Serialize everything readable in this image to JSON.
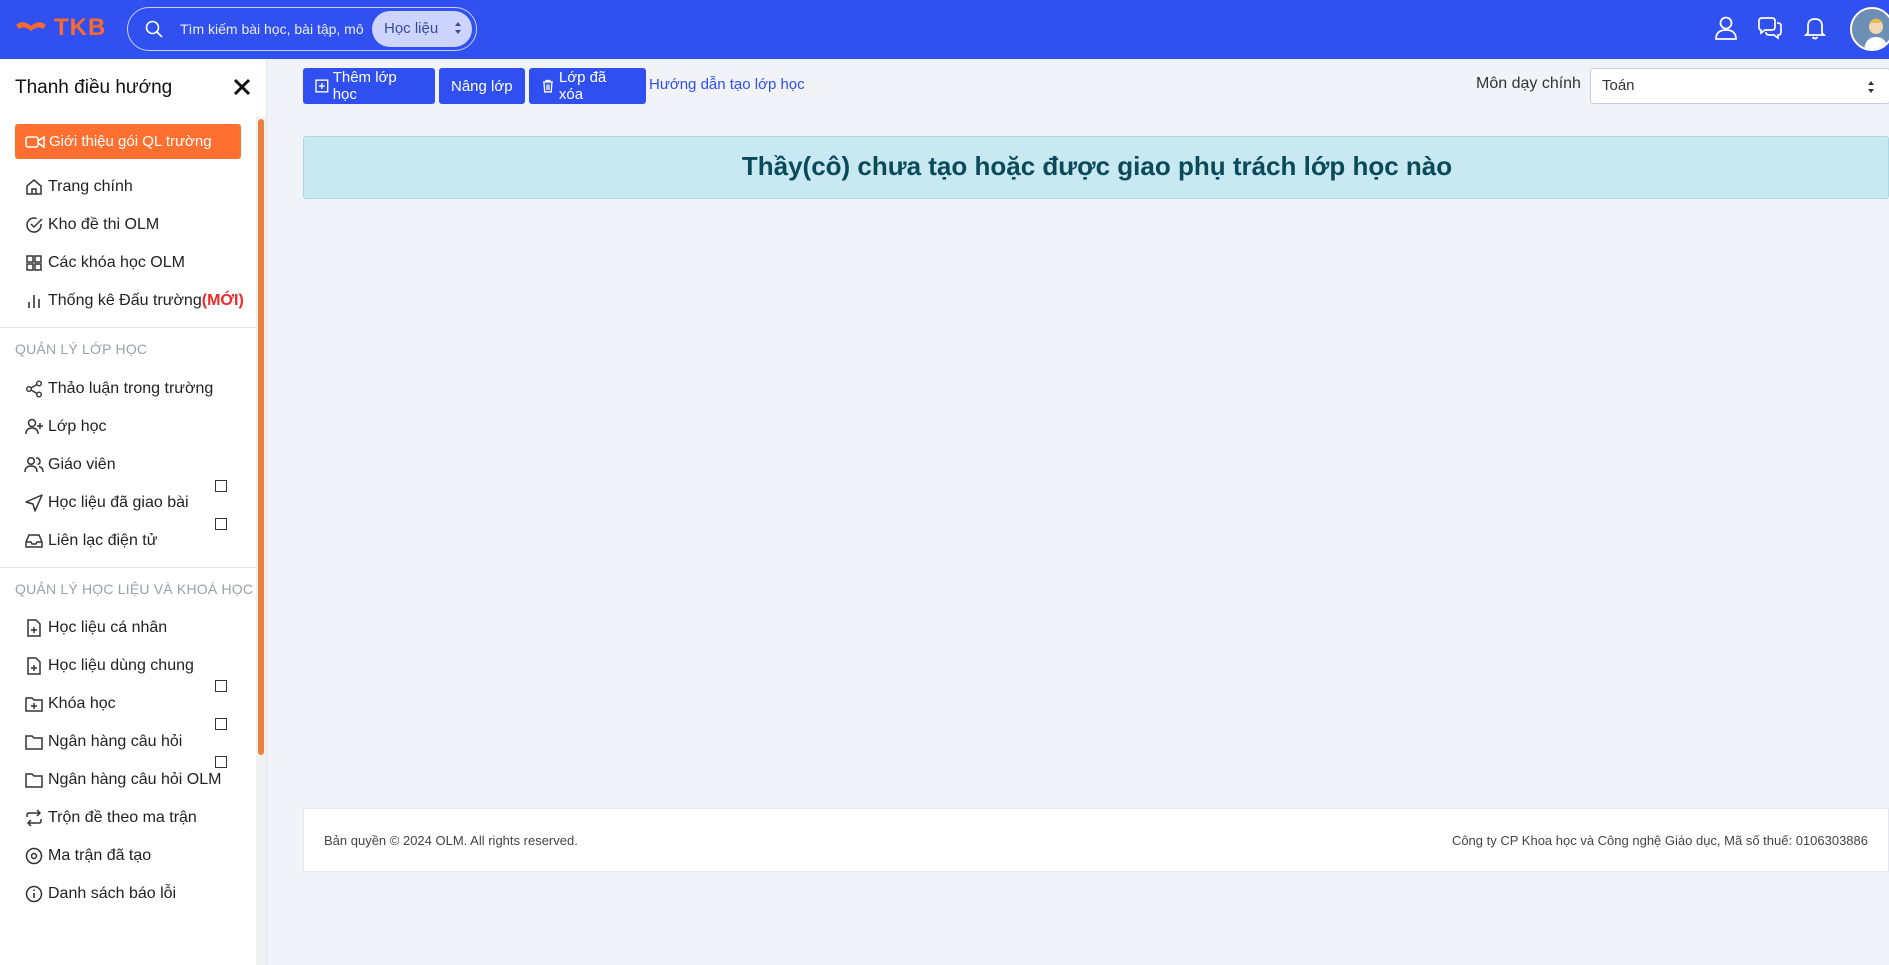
{
  "header": {
    "logo_text": "TKB",
    "search_placeholder": "Tìm kiếm bài học, bài tập, mô",
    "search_scope": "Học liệu",
    "brand_color": "#3050f0",
    "accent_color": "#ff6a2b",
    "icons": [
      "user-icon",
      "chat-icon",
      "bell-icon"
    ]
  },
  "sidebar": {
    "title": "Thanh điều hướng",
    "promo": "Giới thiệu gói QL trường",
    "top_items": [
      {
        "label": "Trang chính",
        "icon": "home-icon"
      },
      {
        "label": "Kho đề thi OLM",
        "icon": "check-circle-icon"
      },
      {
        "label": "Các khóa học OLM",
        "icon": "grid-icon"
      },
      {
        "label": "Thống kê Đấu trường",
        "badge": "(MỚI)",
        "icon": "bar-chart-icon"
      }
    ],
    "section1_title": "QUẢN LÝ LỚP HỌC",
    "section1_items": [
      {
        "label": "Thảo luận trong trường",
        "icon": "share-icon"
      },
      {
        "label": "Lớp học",
        "icon": "user-plus-icon"
      },
      {
        "label": "Giáo viên",
        "icon": "users-icon"
      },
      {
        "label": "Học liệu đã giao bài",
        "icon": "send-icon"
      },
      {
        "label": "Liên lạc điện tử",
        "icon": "inbox-icon"
      }
    ],
    "section2_title": "QUẢN LÝ HỌC LIỆU VÀ KHOÁ HỌC",
    "section2_items": [
      {
        "label": "Học liệu cá nhân",
        "icon": "file-plus-icon"
      },
      {
        "label": "Học liệu dùng chung",
        "icon": "file-plus-icon"
      },
      {
        "label": "Khóa học",
        "icon": "folder-plus-icon"
      },
      {
        "label": "Ngân hàng câu hỏi",
        "icon": "folder-icon"
      },
      {
        "label": "Ngân hàng câu hỏi OLM",
        "icon": "folder-icon"
      },
      {
        "label": "Trộn đề theo ma trận",
        "icon": "repeat-icon"
      },
      {
        "label": "Ma trận đã tạo",
        "icon": "disc-icon"
      },
      {
        "label": "Danh sách báo lỗi",
        "icon": "info-icon"
      }
    ]
  },
  "toolbar": {
    "add_class": "Thêm lớp học",
    "upgrade_class": "Nâng lớp",
    "deleted_classes": "Lớp đã xóa",
    "guide_link": "Hướng dẫn tạo lớp học",
    "subject_label": "Môn dạy chính",
    "subject_value": "Toán"
  },
  "main": {
    "empty_message": "Thầy(cô) chưa tạo hoặc được giao phụ trách lớp học nào"
  },
  "footer": {
    "copyright": "Bản quyền © 2024 OLM. All rights reserved.",
    "company": "Công ty CP Khoa học và Công nghệ Giáo dục, Mã số thuế: 0106303886"
  }
}
